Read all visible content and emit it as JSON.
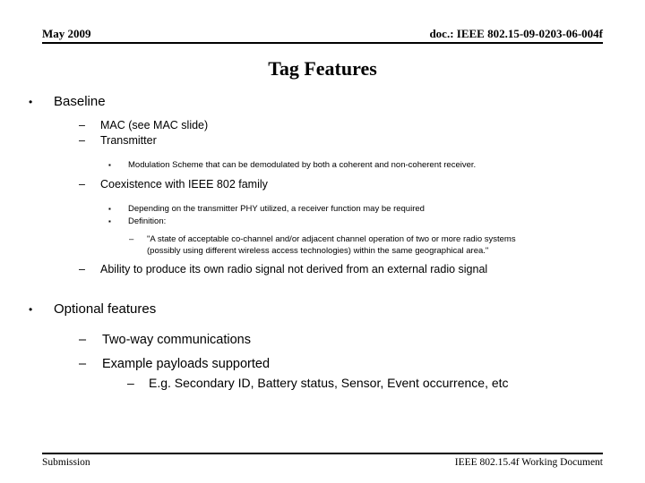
{
  "header": {
    "date": "May 2009",
    "doc_id": "doc.: IEEE 802.15-09-0203-06-004f"
  },
  "title": "Tag Features",
  "bullets": {
    "baseline": "Baseline",
    "mac": "MAC (see MAC slide)",
    "transmitter": "Transmitter",
    "modulation": "Modulation Scheme that can be demodulated by both a coherent and non-coherent receiver.",
    "coexistence": "Coexistence with IEEE 802 family",
    "depending": "Depending on the transmitter PHY utilized, a receiver function may be required",
    "definition_label": "Definition:",
    "definition_quote_line1": "\"A state of acceptable co-channel and/or adjacent channel operation of two or more radio systems",
    "definition_quote_line2": "(possibly using different wireless access technologies) within the same geographical area.\"",
    "ability": "Ability to produce its own radio signal not derived from an external radio signal",
    "optional_features": "Optional features",
    "two_way": "Two-way communications",
    "example_payloads": "Example payloads supported",
    "eg_payloads": "E.g. Secondary ID, Battery status, Sensor, Event occurrence, etc"
  },
  "markers": {
    "dot": "•",
    "dash": "–",
    "square": "▪"
  },
  "footer": {
    "left": "Submission",
    "right": "IEEE 802.15.4f Working Document"
  }
}
